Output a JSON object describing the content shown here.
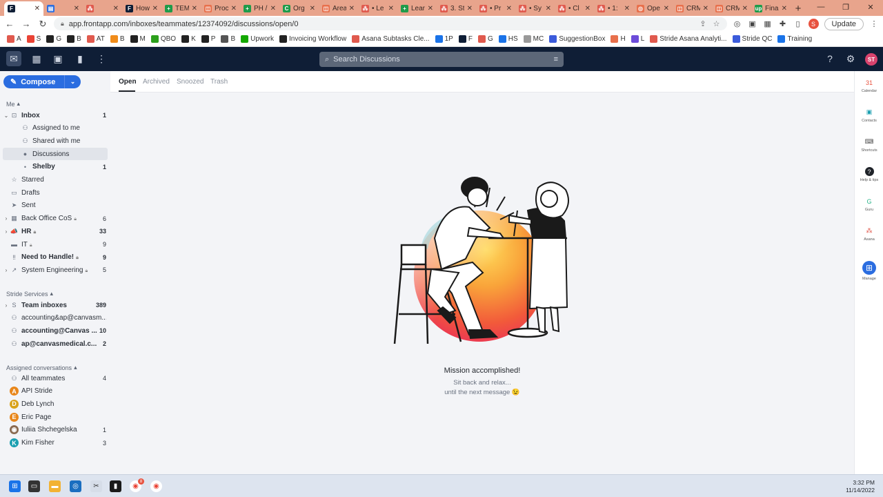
{
  "browser": {
    "tabs": [
      {
        "label": "",
        "color": "#0f1e36",
        "glyph": "F",
        "active": true
      },
      {
        "label": "",
        "color": "#2b6de0",
        "glyph": "▤"
      },
      {
        "label": "",
        "color": "#e05a4e",
        "glyph": "⁂"
      },
      {
        "label": "How",
        "color": "#0f1e36",
        "glyph": "F"
      },
      {
        "label": "TEM",
        "color": "#1e9b4a",
        "glyph": "+"
      },
      {
        "label": "Proc",
        "color": "#e8704c",
        "glyph": "◫"
      },
      {
        "label": "PH /",
        "color": "#1e9b4a",
        "glyph": "+"
      },
      {
        "label": "Org",
        "color": "#1e9b4a",
        "glyph": "C"
      },
      {
        "label": "Area",
        "color": "#e8704c",
        "glyph": "◫"
      },
      {
        "label": "• Le",
        "color": "#e05a4e",
        "glyph": "⁂"
      },
      {
        "label": "Lear",
        "color": "#1e9b4a",
        "glyph": "+"
      },
      {
        "label": "3. St",
        "color": "#e05a4e",
        "glyph": "⁂"
      },
      {
        "label": "• Pr",
        "color": "#e05a4e",
        "glyph": "⁂"
      },
      {
        "label": "• Sy",
        "color": "#e05a4e",
        "glyph": "⁂"
      },
      {
        "label": "• Cl",
        "color": "#e05a4e",
        "glyph": "⁂"
      },
      {
        "label": "• 1:",
        "color": "#e05a4e",
        "glyph": "⁂"
      },
      {
        "label": "Ope",
        "color": "#e8704c",
        "glyph": "◎"
      },
      {
        "label": "CRM",
        "color": "#e8704c",
        "glyph": "◫"
      },
      {
        "label": "CRM",
        "color": "#e8704c",
        "glyph": "◫"
      },
      {
        "label": "Fina",
        "color": "#1e9b4a",
        "glyph": "up"
      }
    ],
    "url": "app.frontapp.com/inboxes/teammates/12374092/discussions/open/0",
    "update_label": "Update",
    "profile_initial": "S",
    "bookmarks": [
      {
        "label": "A",
        "color": "#e05a4e"
      },
      {
        "label": "S",
        "color": "#ea4335"
      },
      {
        "label": "G",
        "color": "#222"
      },
      {
        "label": "B",
        "color": "#222"
      },
      {
        "label": "AT",
        "color": "#e05a4e"
      },
      {
        "label": "B",
        "color": "#f08c1a"
      },
      {
        "label": "M",
        "color": "#222"
      },
      {
        "label": "QBO",
        "color": "#2ca01c"
      },
      {
        "label": "K",
        "color": "#222"
      },
      {
        "label": "P",
        "color": "#222"
      },
      {
        "label": "B",
        "color": "#555"
      },
      {
        "label": "Upwork",
        "color": "#14a800"
      },
      {
        "label": "Invoicing Workflow",
        "color": "#222"
      },
      {
        "label": "Asana Subtasks Cle...",
        "color": "#e05a4e"
      },
      {
        "label": "1P",
        "color": "#1a73e8"
      },
      {
        "label": "F",
        "color": "#0f1e36"
      },
      {
        "label": "G",
        "color": "#e05a4e"
      },
      {
        "label": "HS",
        "color": "#1a73e8"
      },
      {
        "label": "MC",
        "color": "#999"
      },
      {
        "label": "SuggestionBox",
        "color": "#3b5bdb"
      },
      {
        "label": "H",
        "color": "#e8704c"
      },
      {
        "label": "L",
        "color": "#6c4cd9"
      },
      {
        "label": "Stride Asana Analyti...",
        "color": "#e05a4e"
      },
      {
        "label": "Stride QC",
        "color": "#3b5bdb"
      },
      {
        "label": "Training",
        "color": "#1a73e8"
      }
    ]
  },
  "app": {
    "search_placeholder": "Search Discussions",
    "avatar": "ST",
    "compose_label": "Compose",
    "sections": {
      "me": "Me",
      "stride": "Stride Services",
      "assigned": "Assigned conversations"
    },
    "me_items": [
      {
        "label": "Inbox",
        "count": "1",
        "bold": true,
        "icon": "inbox-icon",
        "glyph": "⊡",
        "caret": "⌄"
      },
      {
        "label": "Assigned to me",
        "count": "",
        "icon": "assigned-icon",
        "glyph": "⚇",
        "indent": true
      },
      {
        "label": "Shared with me",
        "count": "",
        "icon": "shared-icon",
        "glyph": "⚇",
        "indent": true
      },
      {
        "label": "Discussions",
        "count": "",
        "icon": "chat-icon",
        "glyph": "●",
        "indent": true,
        "selected": true
      },
      {
        "label": "Shelby",
        "count": "1",
        "bold": true,
        "icon": "dot-icon",
        "glyph": "•",
        "indent": true
      },
      {
        "label": "Starred",
        "count": "",
        "icon": "star-icon",
        "glyph": "☆"
      },
      {
        "label": "Drafts",
        "count": "",
        "icon": "draft-icon",
        "glyph": "▭"
      },
      {
        "label": "Sent",
        "count": "",
        "icon": "send-icon",
        "glyph": "➤"
      },
      {
        "label": "Back Office CoS",
        "count": "6",
        "icon": "folder-icon",
        "glyph": "▦",
        "caret": "›",
        "lock": true
      },
      {
        "label": "HR",
        "count": "33",
        "bold": true,
        "icon": "megaphone-icon",
        "glyph": "📣",
        "caret": "›",
        "lock": true
      },
      {
        "label": "IT",
        "count": "9",
        "icon": "monitor-icon",
        "glyph": "▬",
        "lock": true
      },
      {
        "label": "Need to Handle!",
        "count": "9",
        "bold": true,
        "icon": "exclamation-icon",
        "glyph": "‼",
        "lock": true
      },
      {
        "label": "System Engineering",
        "count": "5",
        "icon": "chart-icon",
        "glyph": "↗",
        "caret": "›",
        "lock": true
      }
    ],
    "stride_items": [
      {
        "label": "Team inboxes",
        "count": "389",
        "bold": true,
        "icon": "team-icon",
        "glyph": "S",
        "caret": "›"
      },
      {
        "label": "accounting&ap@canvasm...",
        "count": "",
        "icon": "people-icon",
        "glyph": "⚇"
      },
      {
        "label": "accounting@Canvas ...",
        "count": "10",
        "bold": true,
        "icon": "people-icon",
        "glyph": "⚇"
      },
      {
        "label": "ap@canvasmedical.c...",
        "count": "2",
        "bold": true,
        "icon": "people-icon",
        "glyph": "⚇"
      }
    ],
    "assigned_items": [
      {
        "label": "All teammates",
        "count": "4",
        "icon": "people-icon",
        "glyph": "⚇"
      },
      {
        "label": "API Stride",
        "count": "",
        "icon": "avatar-a-icon",
        "glyph": "A",
        "color": "#e8861a"
      },
      {
        "label": "Deb Lynch",
        "count": "",
        "icon": "avatar-d-icon",
        "glyph": "D",
        "color": "#d9a21a"
      },
      {
        "label": "Eric Page",
        "count": "",
        "icon": "avatar-e-icon",
        "glyph": "E",
        "color": "#e8861a"
      },
      {
        "label": "Iuliia Shchegelska",
        "count": "1",
        "icon": "avatar-photo-icon",
        "glyph": "◉",
        "color": "#8a6a50"
      },
      {
        "label": "Kim Fisher",
        "count": "3",
        "icon": "avatar-k-icon",
        "glyph": "K",
        "color": "#1a9fb0"
      }
    ],
    "main_tabs": [
      "Open",
      "Archived",
      "Snoozed",
      "Trash"
    ],
    "empty_title": "Mission accomplished!",
    "empty_line1": "Sit back and relax...",
    "empty_line2": "until the next message 😉",
    "rail": [
      {
        "label": "Calendar",
        "icon": "calendar-icon",
        "glyph": "31",
        "color": "#e8523f"
      },
      {
        "label": "Contacts",
        "icon": "contacts-icon",
        "glyph": "▣",
        "color": "#1a9fb0"
      },
      {
        "label": "Shortcuts",
        "icon": "keyboard-icon",
        "glyph": "⌨",
        "color": "#555"
      },
      {
        "label": "Help & tips",
        "icon": "help-icon",
        "glyph": "?",
        "color": "#1f2329"
      },
      {
        "label": "Guru",
        "icon": "guru-icon",
        "glyph": "G",
        "color": "#2bb38a"
      },
      {
        "label": "Asana",
        "icon": "asana-icon",
        "glyph": "⁂",
        "color": "#e05a4e"
      },
      {
        "label": "Manage",
        "icon": "manage-icon",
        "glyph": "⊞",
        "color": "#2b6de0"
      }
    ]
  },
  "taskbar": {
    "time": "3:32 PM",
    "date": "11/14/2022",
    "chrome_badge": "8"
  }
}
